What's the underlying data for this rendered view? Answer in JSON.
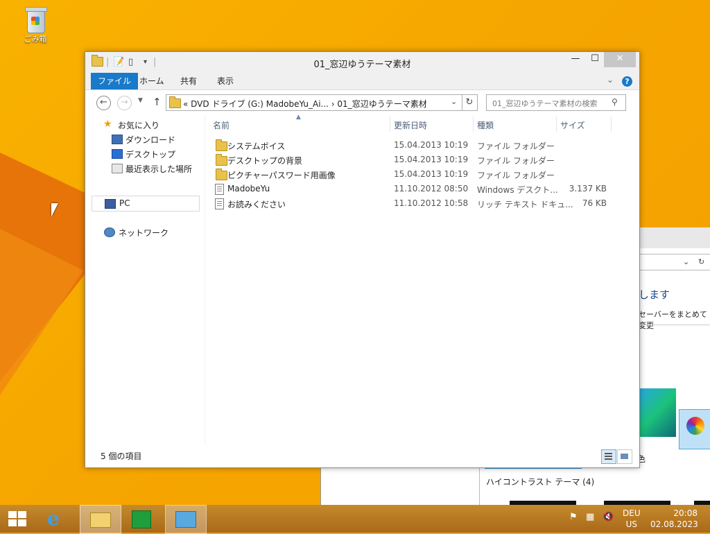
{
  "desktop": {
    "recycle_bin_label": "ごみ箱"
  },
  "background_window": {
    "heading": "します",
    "subtitle": "セーバーをまとめて変更",
    "theme_label": "色",
    "high_contrast_label": "ハイコントラスト テーマ (4)"
  },
  "explorer": {
    "title": "01_窓辺ゆうテーマ素材",
    "window_controls": {
      "minimize": "—",
      "maximize": "☐",
      "close": "✕"
    },
    "ribbon": {
      "tabs": [
        "ファイル",
        "ホーム",
        "共有",
        "表示"
      ],
      "help": "?"
    },
    "address": {
      "text": "«  DVD ドライブ (G:) MadobeYu_Ai...  ›  01_窓辺ゆうテーマ素材",
      "search_placeholder": "01_窓辺ゆうテーマ素材の検索"
    },
    "nav": {
      "favorites": "お気に入り",
      "downloads": "ダウンロード",
      "desktop": "デスクトップ",
      "recent": "最近表示した場所",
      "pc": "PC",
      "network": "ネットワーク"
    },
    "columns": [
      "名前",
      "更新日時",
      "種類",
      "サイズ"
    ],
    "files": [
      {
        "name": "システムボイス",
        "date": "15.04.2013 10:19",
        "type": "ファイル フォルダー",
        "size": "",
        "icon": "folder-icon"
      },
      {
        "name": "デスクトップの背景",
        "date": "15.04.2013 10:19",
        "type": "ファイル フォルダー",
        "size": "",
        "icon": "folder-icon"
      },
      {
        "name": "ピクチャーパスワード用画像",
        "date": "15.04.2013 10:19",
        "type": "ファイル フォルダー",
        "size": "",
        "icon": "folder-icon"
      },
      {
        "name": "MadobeYu",
        "date": "11.10.2012 08:50",
        "type": "Windows デスクト...",
        "size": "3.137 KB",
        "icon": "theme-file-icon"
      },
      {
        "name": "お読みください",
        "date": "11.10.2012 10:58",
        "type": "リッチ テキスト ドキュ...",
        "size": "76 KB",
        "icon": "document-icon"
      }
    ],
    "status": "5 個の項目"
  },
  "taskbar": {
    "lang_top": "DEU",
    "lang_bottom": "US",
    "time": "20:08",
    "date": "02.08.2023"
  },
  "colors": {
    "accent": "#1979ca",
    "desktop": "#f5a400",
    "taskbar": "#b7761b"
  }
}
